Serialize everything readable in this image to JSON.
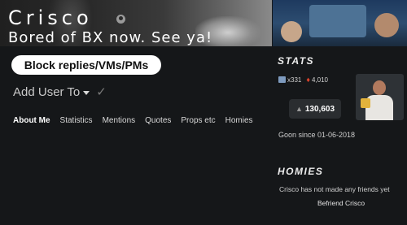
{
  "profile": {
    "username": "Crisco",
    "status": "Bored of BX now. See ya!"
  },
  "actions": {
    "block_label": "Block replies/VMs/PMs",
    "add_user_label": "Add User To",
    "befriend_label": "Befriend Crisco"
  },
  "tabs": [
    {
      "label": "About Me",
      "active": true
    },
    {
      "label": "Statistics"
    },
    {
      "label": "Mentions"
    },
    {
      "label": "Quotes"
    },
    {
      "label": "Props etc"
    },
    {
      "label": "Homies"
    }
  ],
  "stats": {
    "heading": "STATS",
    "likes": "x331",
    "flames": "4,010",
    "score": "130,603",
    "since": "Goon since 01-06-2018"
  },
  "homies": {
    "heading": "HOMIES",
    "empty_text": "Crisco has not made any friends yet"
  },
  "colors": {
    "background": "#151719",
    "button": "#ffffff",
    "flame": "#e0442c"
  }
}
